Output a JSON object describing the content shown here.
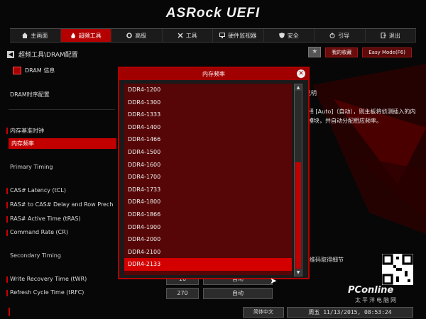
{
  "header": {
    "brand": "ASRock UEFI"
  },
  "nav": {
    "tabs": [
      {
        "label": "主画面",
        "icon": "home-icon",
        "active": false
      },
      {
        "label": "超频工具",
        "icon": "flame-icon",
        "active": true
      },
      {
        "label": "高级",
        "icon": "gear-icon",
        "active": false
      },
      {
        "label": "工具",
        "icon": "tools-icon",
        "active": false
      },
      {
        "label": "硬件监视器",
        "icon": "monitor-icon",
        "active": false
      },
      {
        "label": "安全",
        "icon": "shield-icon",
        "active": false
      },
      {
        "label": "引导",
        "icon": "power-icon",
        "active": false
      },
      {
        "label": "退出",
        "icon": "exit-icon",
        "active": false
      }
    ]
  },
  "breadcrumb": "超频工具\\DRAM配置",
  "topbar": {
    "favorites": "我的收藏",
    "easy_mode": "Easy Mode(F6)"
  },
  "dram_info": "DRAM 信息",
  "left": {
    "dram_timing_config": "DRAM时序配置",
    "reference_clock": "内存基准时钟",
    "dram_frequency": "内存频率",
    "primary_timing": "Primary Timing",
    "cas_latency": "CAS# Latency (tCL)",
    "ras_to_cas": "RAS# to CAS# Delay and Row Prech",
    "ras_active": "RAS# Active Time (tRAS)",
    "command_rate": "Command Rate (CR)",
    "secondary_timing": "Secondary Timing",
    "write_recovery": "Write Recovery Time (tWR)",
    "refresh_cycle": "Refresh Cycle Time (tRFC)"
  },
  "right": {
    "help_header": "说明",
    "help_text": "选择 [Auto]（自动），则主板将侦测插入的内存模块，并自动分配相应频率。",
    "detail": "二维码取得细节"
  },
  "rows": {
    "write_recovery": {
      "value": "16",
      "mode": "自动"
    },
    "refresh_cycle": {
      "value": "270",
      "mode": "自动"
    }
  },
  "modal": {
    "title": "内存频率",
    "options": [
      "DDR4-1200",
      "DDR4-1300",
      "DDR4-1333",
      "DDR4-1400",
      "DDR4-1466",
      "DDR4-1500",
      "DDR4-1600",
      "DDR4-1700",
      "DDR4-1733",
      "DDR4-1800",
      "DDR4-1866",
      "DDR4-1900",
      "DDR4-2000",
      "DDR4-2100",
      "DDR4-2133"
    ],
    "selected": "DDR4-2133",
    "scroll_fraction": 0.6
  },
  "bottom": {
    "language": "简体中文",
    "datetime": "周五 11/13/2015, 08:53:24"
  },
  "watermark": {
    "site": "PConline",
    "tagline": "太平洋电脑网"
  },
  "colors": {
    "accent": "#c30000",
    "background": "#070707"
  }
}
